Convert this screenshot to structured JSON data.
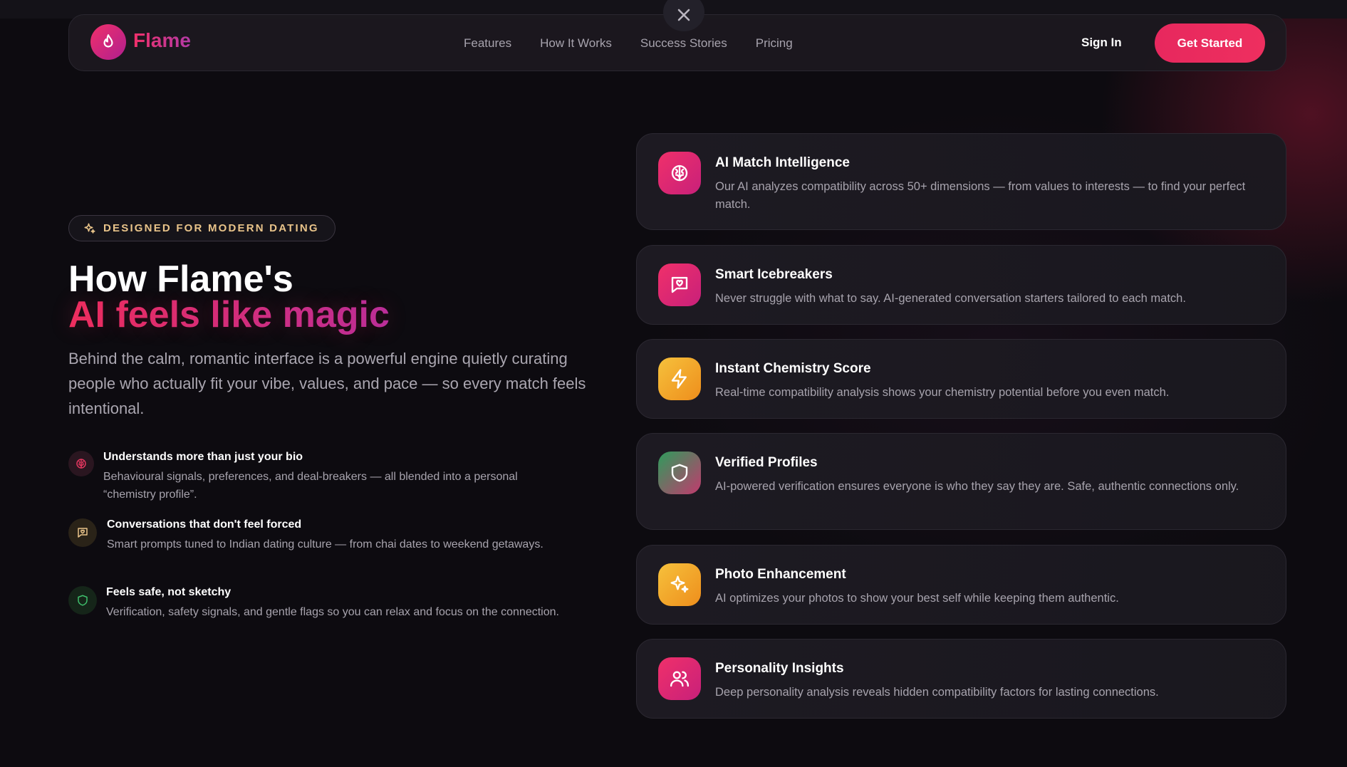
{
  "nav": {
    "brand": "Flame",
    "links": [
      "Features",
      "How It Works",
      "Success Stories",
      "Pricing"
    ],
    "signin_label": "Sign In",
    "cta_label": "Get Started"
  },
  "hero": {
    "badge": "DESIGNED FOR MODERN DATING",
    "title_line1": "How Flame's",
    "title_line2": "AI feels like magic",
    "description": "Behind the calm, romantic interface is a powerful engine quietly curating people who actually fit your vibe, values, and pace — so every match feels intentional."
  },
  "points": [
    {
      "title": "Understands more than just your bio",
      "desc": "Behavioural signals, preferences, and deal-breakers — all blended into a personal “chemistry profile”.",
      "icon": "brain-icon"
    },
    {
      "title": "Conversations that don't feel forced",
      "desc": "Smart prompts tuned to Indian dating culture — from chai dates to weekend getaways.",
      "icon": "chat-heart-icon"
    },
    {
      "title": "Feels safe, not sketchy",
      "desc": "Verification, safety signals, and gentle flags so you can relax and focus on the connection.",
      "icon": "shield-icon"
    }
  ],
  "features": [
    {
      "title": "AI Match Intelligence",
      "desc": "Our AI analyzes compatibility across 50+ dimensions — from values to interests — to find your perfect match.",
      "icon": "brain-icon"
    },
    {
      "title": "Smart Icebreakers",
      "desc": "Never struggle with what to say. AI-generated conversation starters tailored to each match.",
      "icon": "chat-heart-icon"
    },
    {
      "title": "Instant Chemistry Score",
      "desc": "Real-time compatibility analysis shows your chemistry potential before you even match.",
      "icon": "lightning-icon"
    },
    {
      "title": "Verified Profiles",
      "desc": "AI-powered verification ensures everyone is who they say they are. Safe, authentic connections only.",
      "icon": "shield-icon"
    },
    {
      "title": "Photo Enhancement",
      "desc": "AI optimizes your photos to show your best self while keeping them authentic.",
      "icon": "sparkles-icon"
    },
    {
      "title": "Personality Insights",
      "desc": "Deep personality analysis reveals hidden compatibility factors for lasting connections.",
      "icon": "users-icon"
    }
  ],
  "colors": {
    "accent": "#ee2f5f",
    "accent_purple": "#b9309e",
    "badge_text": "#e9c48a",
    "background": "#0d0b10"
  }
}
